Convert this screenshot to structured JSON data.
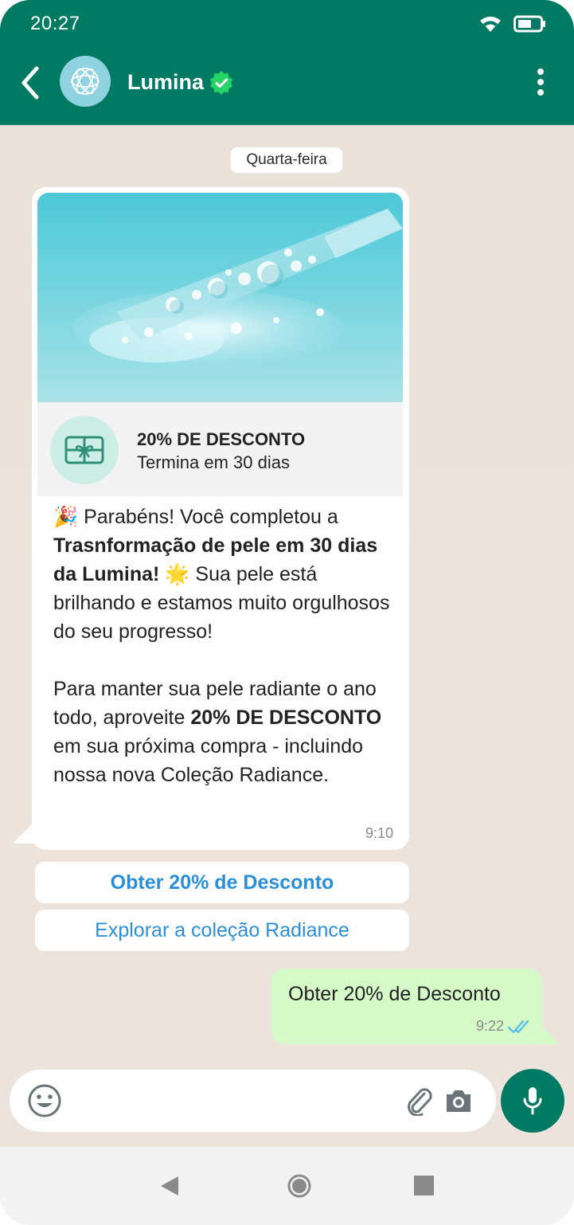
{
  "status_bar": {
    "time": "20:27"
  },
  "header": {
    "contact_name": "Lumina",
    "back_icon": "chevron-left-icon",
    "menu_icon": "kebab-menu-icon",
    "verified_icon": "verified-badge-icon",
    "avatar_icon": "atom-logo-icon"
  },
  "colors": {
    "header_bg": "#007a63",
    "chat_bg": "#ebe3da",
    "outgoing_bubble": "#d6f9c8",
    "link_blue": "#2a8fd9",
    "verified_green": "#25d366"
  },
  "chat": {
    "date_label": "Quarta-feira",
    "card": {
      "image_icon": "serum-dropper-image",
      "offer_icon": "gift-card-icon",
      "offer_title": "20% DE DESCONTO",
      "offer_subtitle": "Termina em 30 dias",
      "emoji_party": "🎉",
      "text_intro": "Parabéns! Você completou a",
      "text_bold": "Trasnformação de pele em 30 dias da Lumina!",
      "emoji_star": "🌟",
      "text_rest": "Sua pele está brilhando e estamos muito orgulhosos do seu progresso!",
      "para2_a": "Para manter sua pele radiante o ano todo, aproveite",
      "para2_bold": "20% DE DESCONTO",
      "para2_b": "em sua próxima compra - incluindo nossa nova Coleção Radiance.",
      "time": "9:10"
    },
    "quick_replies": [
      {
        "label": "Obter 20% de Desconto"
      },
      {
        "label": "Explorar a coleção Radiance"
      }
    ],
    "outgoing": {
      "text": "Obter 20% de Desconto",
      "time": "9:22",
      "status_icon": "double-check-read-icon"
    }
  },
  "input_bar": {
    "placeholder": "",
    "emoji_icon": "emoji-smiley-icon",
    "attach_icon": "paperclip-icon",
    "camera_icon": "camera-icon",
    "mic_icon": "microphone-icon"
  },
  "nav_bar": {
    "back_icon": "nav-back-icon",
    "home_icon": "nav-home-icon",
    "recent_icon": "nav-recents-icon"
  }
}
